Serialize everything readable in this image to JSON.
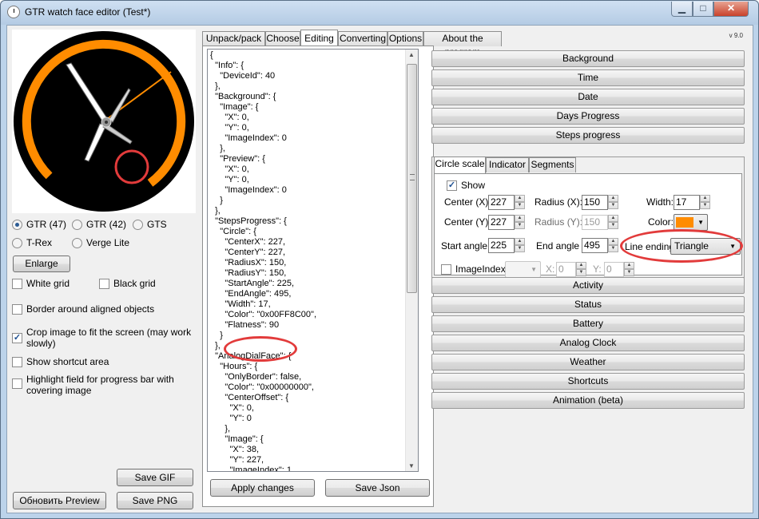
{
  "window": {
    "title": "GTR watch face editor (Test*)",
    "min_icon": "minimize-icon",
    "max_icon": "maximize-icon",
    "close_icon": "close-icon"
  },
  "left": {
    "models": [
      "GTR (47)",
      "GTR (42)",
      "GTS",
      "T-Rex",
      "Verge Lite"
    ],
    "selected_model": "GTR (47)",
    "enlarge": "Enlarge",
    "white_grid": "White grid",
    "black_grid": "Black grid",
    "border_aligned": "Border around aligned objects",
    "crop_line1": "Crop image to fit the screen (may work",
    "crop_line2": "slowly)",
    "crop_checked": true,
    "shortcut_area": "Show shortcut area",
    "highlight_line1": "Highlight field for progress bar with",
    "highlight_line2": "covering image",
    "save_gif": "Save GIF",
    "refresh_preview": "Обновить Preview",
    "save_png": "Save PNG"
  },
  "tabs": [
    "Unpack/pack",
    "Choose",
    "Editing",
    "Converting",
    "Options",
    "About the program"
  ],
  "active_tab": "Editing",
  "version": "v 9.0",
  "json_text": "{\n  \"Info\": {\n    \"DeviceId\": 40\n  },\n  \"Background\": {\n    \"Image\": {\n      \"X\": 0,\n      \"Y\": 0,\n      \"ImageIndex\": 0\n    },\n    \"Preview\": {\n      \"X\": 0,\n      \"Y\": 0,\n      \"ImageIndex\": 0\n    }\n  },\n  \"StepsProgress\": {\n    \"Circle\": {\n      \"CenterX\": 227,\n      \"CenterY\": 227,\n      \"RadiusX\": 150,\n      \"RadiusY\": 150,\n      \"StartAngle\": 225,\n      \"EndAngle\": 495,\n      \"Width\": 17,\n      \"Color\": \"0x00FF8C00\",\n      \"Flatness\": 90\n    }\n  },\n  \"AnalogDialFace\": {\n    \"Hours\": {\n      \"OnlyBorder\": false,\n      \"Color\": \"0x00000000\",\n      \"CenterOffset\": {\n        \"X\": 0,\n        \"Y\": 0\n      },\n      \"Image\": {\n        \"X\": 38,\n        \"Y\": 227,\n        \"ImageIndex\": 1",
  "apply_changes": "Apply changes",
  "save_json": "Save Json",
  "sections_top": [
    "Background",
    "Time",
    "Date",
    "Days Progress",
    "Steps progress"
  ],
  "sections_bottom": [
    "Activity",
    "Status",
    "Battery",
    "Analog Clock",
    "Weather",
    "Shortcuts",
    "Animation (beta)"
  ],
  "subtabs": [
    "Circle scale",
    "Indicator",
    "Segments"
  ],
  "circle": {
    "show": "Show",
    "center_x_label": "Center (X):",
    "center_x": "227",
    "center_y_label": "Center (Y):",
    "center_y": "227",
    "radius_x_label": "Radius (X):",
    "radius_x": "150",
    "radius_y_label": "Radius (Y):",
    "radius_y": "150",
    "width_label": "Width:",
    "width": "17",
    "color_label": "Color:",
    "color": "#ff8c00",
    "start_angle_label": "Start angle",
    "start_angle": "225",
    "end_angle_label": "End angle",
    "end_angle": "495",
    "line_ending_label": "Line ending",
    "line_ending": "Triangle",
    "image_index_label": "ImageIndex:",
    "x_label": "X:",
    "x": "0",
    "y_label": "Y:",
    "y": "0"
  },
  "colors": {
    "accent": "#ff8c00",
    "highlight_ring": "#e23b3b"
  }
}
